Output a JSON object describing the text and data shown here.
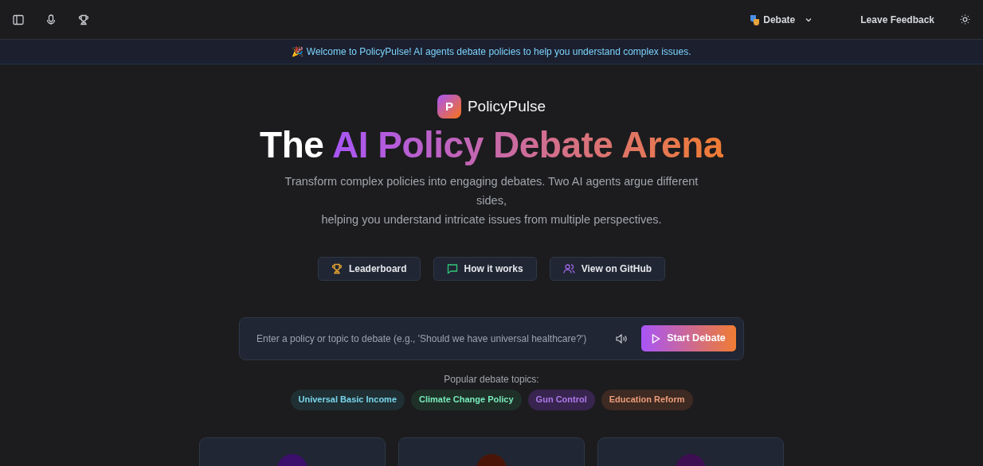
{
  "topbar": {
    "mode_label": "Debate",
    "feedback_label": "Leave Feedback"
  },
  "banner": {
    "emoji": "🎉",
    "text": "Welcome to PolicyPulse! AI agents debate policies to help you understand complex issues."
  },
  "brand": {
    "logo_letter": "P",
    "name": "PolicyPulse"
  },
  "headline": {
    "prefix": "The",
    "highlight": "AI Policy Debate Arena"
  },
  "subtitle": [
    "Transform complex policies into engaging debates. Two AI agents argue different sides,",
    "helping you understand intricate issues from multiple perspectives."
  ],
  "actions": [
    {
      "kind": "trophy",
      "label": "Leaderboard",
      "color": "#e5a530"
    },
    {
      "kind": "chat",
      "label": "How it works",
      "color": "#34c77b"
    },
    {
      "kind": "people",
      "label": "View on GitHub",
      "color": "#a065e8"
    }
  ],
  "search": {
    "placeholder": "Enter a policy or topic to debate (e.g., 'Should we have universal healthcare?')",
    "button": "Start Debate"
  },
  "topics_label": "Popular debate topics:",
  "topics": [
    {
      "label": "Universal Basic Income",
      "color": "#1f2f33"
    },
    {
      "label": "Climate Change Policy",
      "color": "#1f3029"
    },
    {
      "label": "Gun Control",
      "color": "#38254f"
    },
    {
      "label": "Education Reform",
      "color": "#3d2a22"
    }
  ],
  "cards": [
    {
      "color": "#3b0f6b"
    },
    {
      "color": "#4a1508"
    },
    {
      "color": "#3d0f52"
    }
  ]
}
